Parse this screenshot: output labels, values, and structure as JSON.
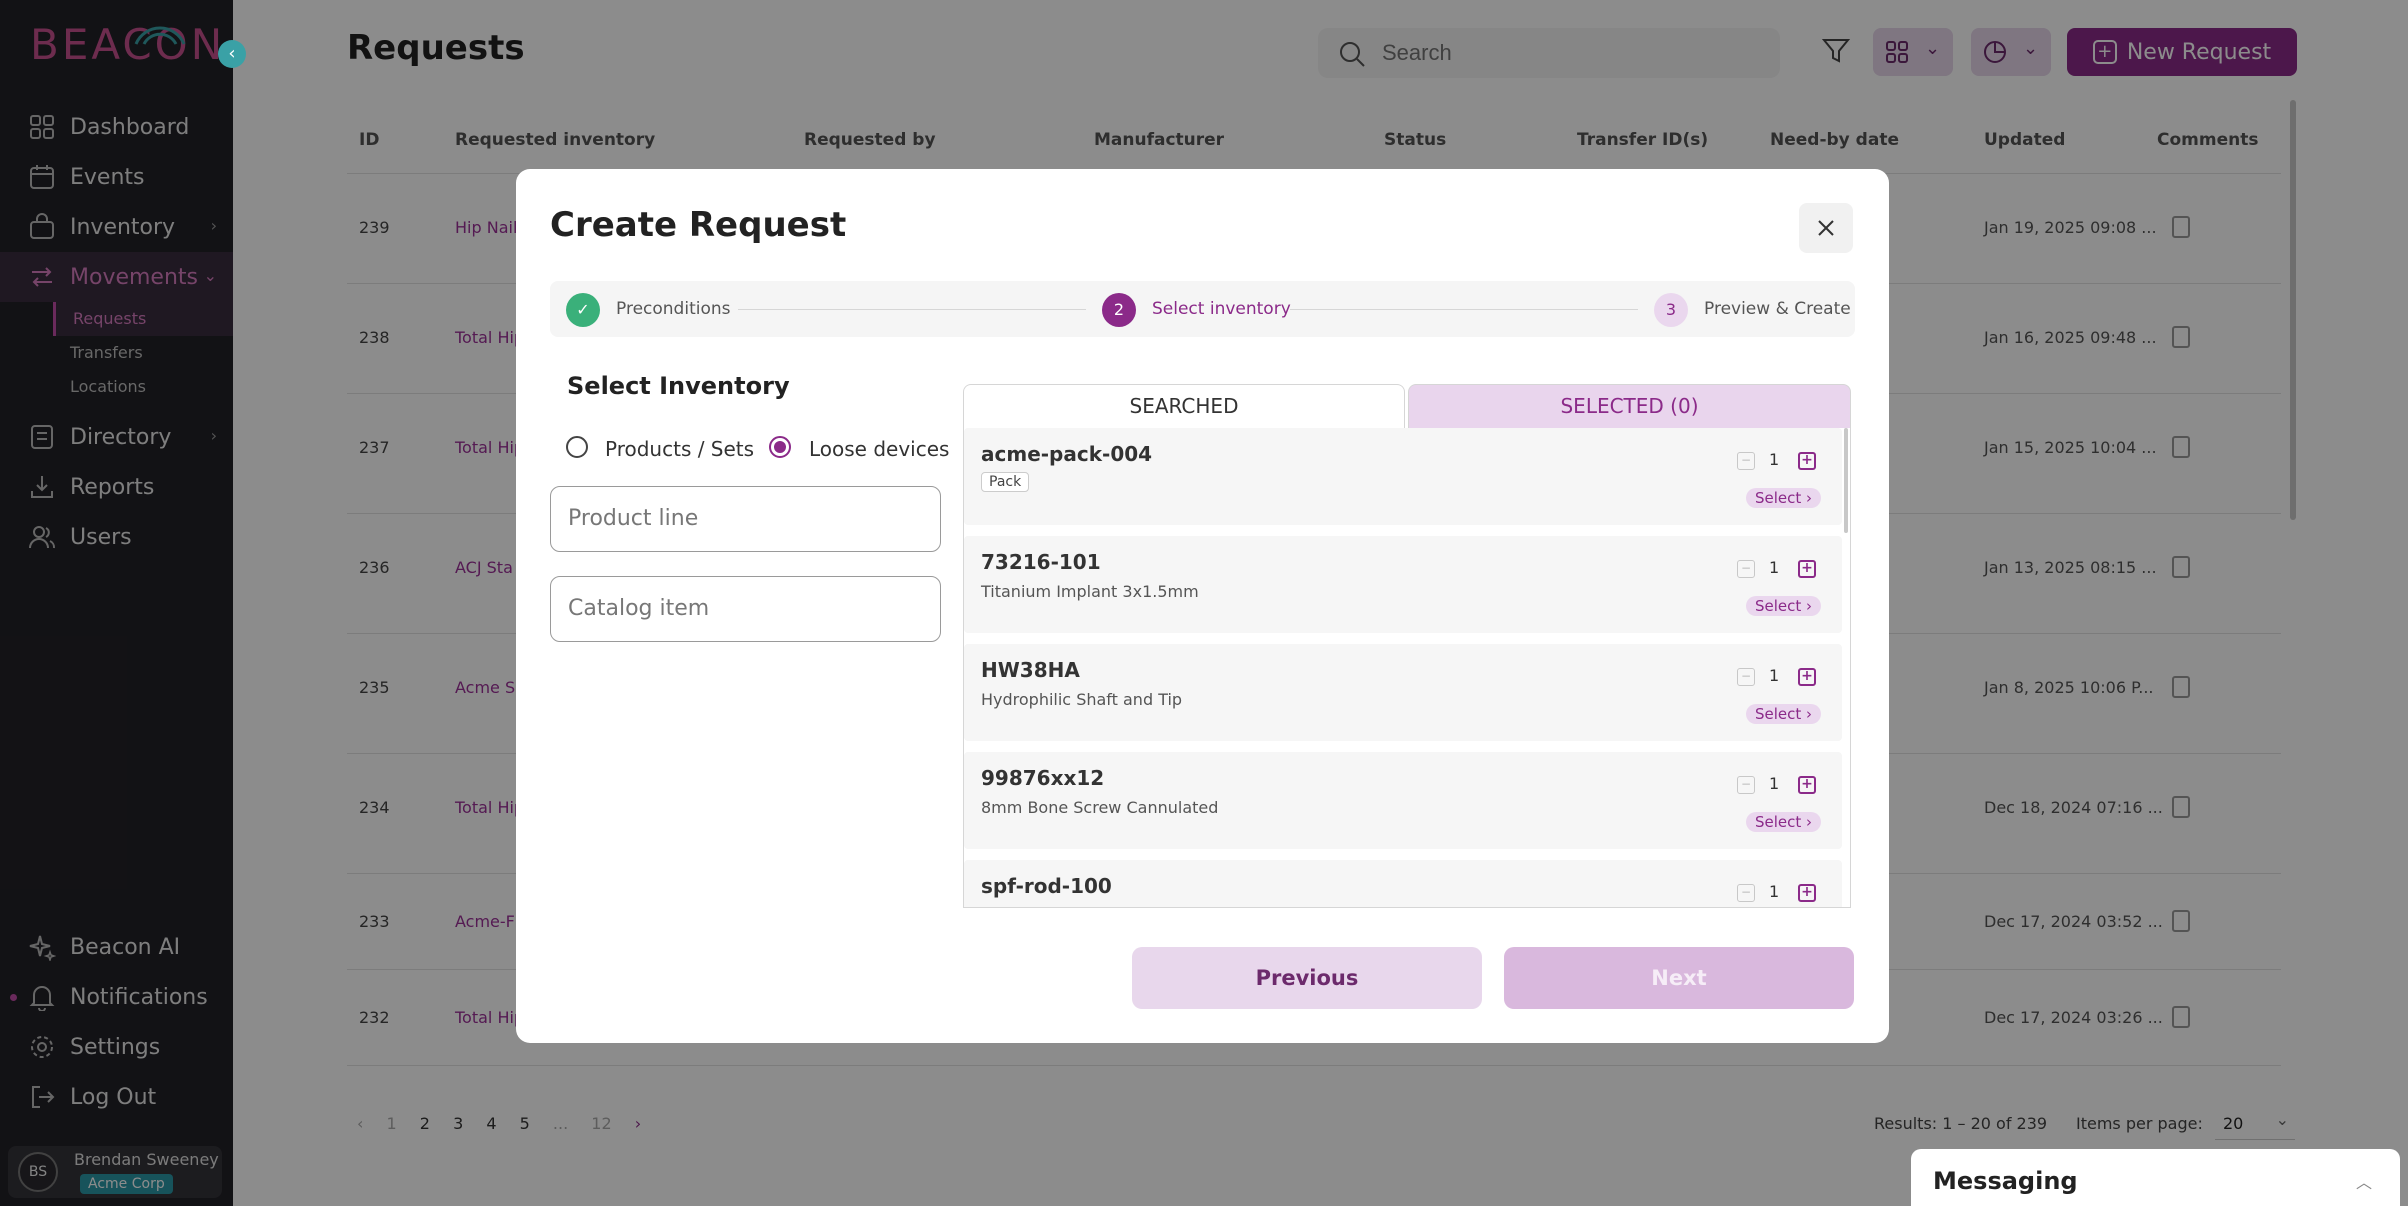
{
  "sidebar": {
    "logo": "BEACON",
    "nav": [
      {
        "label": "Dashboard"
      },
      {
        "label": "Events"
      },
      {
        "label": "Inventory"
      },
      {
        "label": "Movements"
      },
      {
        "label": "Directory"
      },
      {
        "label": "Reports"
      },
      {
        "label": "Users"
      }
    ],
    "subnav": [
      "Requests",
      "Transfers",
      "Locations"
    ],
    "bottom": [
      {
        "label": "Beacon AI"
      },
      {
        "label": "Notifications"
      },
      {
        "label": "Settings"
      },
      {
        "label": "Log Out"
      }
    ],
    "user": {
      "initials": "BS",
      "name": "Brendan Sweeney",
      "company": "Acme Corp"
    }
  },
  "header": {
    "title": "Requests",
    "search_placeholder": "Search",
    "new_request_label": "New Request"
  },
  "table": {
    "columns": [
      "ID",
      "Requested inventory",
      "Requested by",
      "Manufacturer",
      "Status",
      "Transfer ID(s)",
      "Need-by date",
      "Updated",
      "Comments"
    ],
    "rows": [
      {
        "id": "239",
        "inventory": "Hip Nail,",
        "updated": "Jan 19, 2025 09:08 ..."
      },
      {
        "id": "238",
        "inventory": "Total Hip",
        "updated": "Jan 16, 2025 09:48 ..."
      },
      {
        "id": "237",
        "inventory": "Total Hip",
        "updated": "Jan 15, 2025 10:04 ..."
      },
      {
        "id": "236",
        "inventory": "ACJ Sta",
        "updated": "Jan 13, 2025 08:15 ..."
      },
      {
        "id": "235",
        "inventory": "Acme Sc",
        "updated": "Jan 8, 2025 10:06 P..."
      },
      {
        "id": "234",
        "inventory": "Total Hip",
        "updated": "Dec 18, 2024 07:16 ..."
      },
      {
        "id": "233",
        "inventory": "Acme-F",
        "updated": "Dec 17, 2024 03:52 ..."
      },
      {
        "id": "232",
        "inventory": "Total Hip",
        "updated": "Dec 17, 2024 03:26 ..."
      }
    ]
  },
  "pagination": {
    "pages": [
      "1",
      "2",
      "3",
      "4",
      "5",
      "...",
      "12"
    ],
    "results": "Results: 1 – 20 of 239",
    "items_per_page_label": "Items per page:",
    "items_per_page": "20"
  },
  "messaging": {
    "title": "Messaging"
  },
  "modal": {
    "title": "Create Request",
    "steps": [
      {
        "number": "1",
        "label": "Preconditions",
        "state": "done"
      },
      {
        "number": "2",
        "label": "Select inventory",
        "state": "active"
      },
      {
        "number": "3",
        "label": "Preview & Create",
        "state": "upcoming"
      }
    ],
    "section_title": "Select Inventory",
    "radio_options": [
      "Products / Sets",
      "Loose devices"
    ],
    "selected_radio": "Loose devices",
    "product_line_placeholder": "Product line",
    "catalog_item_placeholder": "Catalog item",
    "tabs": [
      "SEARCHED",
      "SELECTED (0)"
    ],
    "items": [
      {
        "name": "acme-pack-004",
        "tag": "Pack",
        "qty": "1",
        "select": "Select ›"
      },
      {
        "name": "73216-101",
        "desc": "Titanium Implant 3x1.5mm",
        "qty": "1",
        "select": "Select ›"
      },
      {
        "name": "HW38HA",
        "desc": "Hydrophilic Shaft and Tip",
        "qty": "1",
        "select": "Select ›"
      },
      {
        "name": "99876xx12",
        "desc": "8mm Bone Screw Cannulated",
        "qty": "1",
        "select": "Select ›"
      },
      {
        "name": "spf-rod-100",
        "qty": "1"
      }
    ],
    "previous_label": "Previous",
    "next_label": "Next"
  },
  "colors": {
    "brand": "#8b2a89",
    "accent": "#3aa1a6",
    "sidebar_bg": "#222127"
  }
}
